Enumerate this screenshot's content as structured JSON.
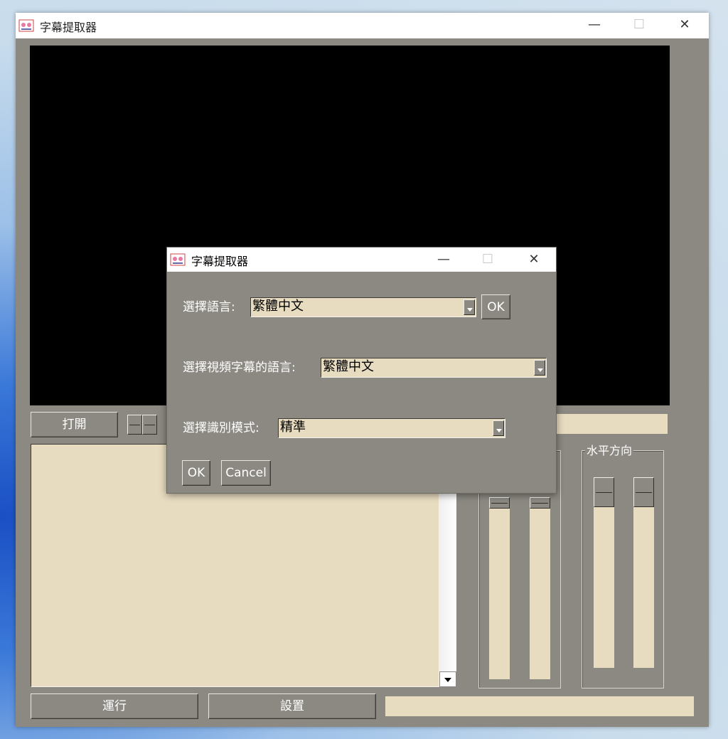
{
  "main_window": {
    "title": "字幕提取器",
    "open_button": "打開",
    "run_button": "運行",
    "settings_button": "設置",
    "horizontal_frame_label": "水平方向",
    "minimize_glyph": "—",
    "maximize_glyph": "☐",
    "close_glyph": "✕"
  },
  "dialog": {
    "title": "字幕提取器",
    "language_label": "選擇語言:",
    "language_value": "繁體中文",
    "language_ok": "OK",
    "subtitle_language_label": "選擇視頻字幕的語言:",
    "subtitle_language_value": "繁體中文",
    "mode_label": "選擇識別模式:",
    "mode_value": "精準",
    "ok_button": "OK",
    "cancel_button": "Cancel",
    "minimize_glyph": "—",
    "maximize_glyph": "☐",
    "close_glyph": "✕"
  },
  "colors": {
    "window_bg": "#8c8982",
    "field_bg": "#e8dcc0",
    "video_bg": "#000000"
  },
  "icons": {
    "app": "app-icon",
    "scroll_down": "arrow-down-icon",
    "combo_arrow": "dropdown-arrow-icon"
  }
}
